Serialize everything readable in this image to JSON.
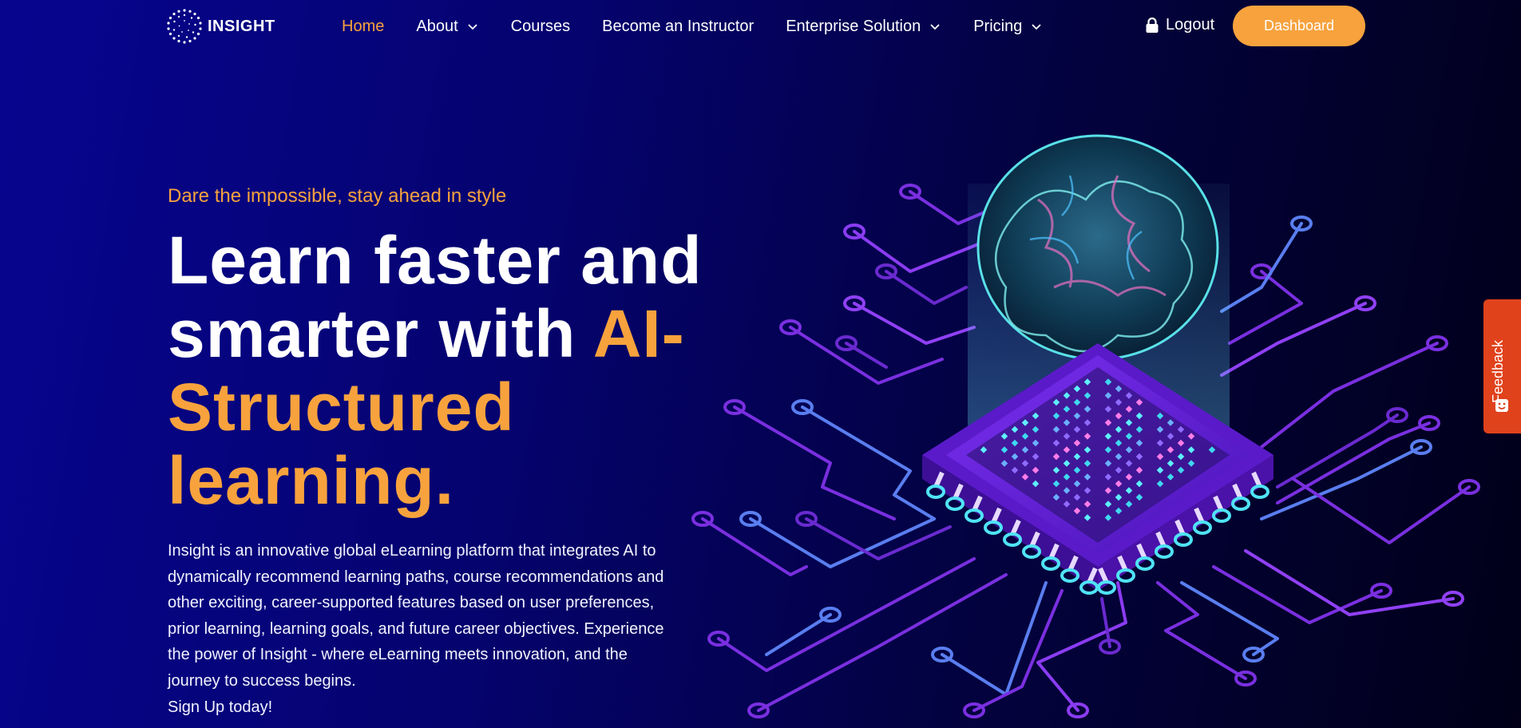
{
  "nav": {
    "logo_text": "INSIGHT",
    "items": [
      {
        "label": "Home",
        "active": true,
        "dropdown": false
      },
      {
        "label": "About",
        "active": false,
        "dropdown": true
      },
      {
        "label": "Courses",
        "active": false,
        "dropdown": false
      },
      {
        "label": "Become an Instructor",
        "active": false,
        "dropdown": false
      },
      {
        "label": "Enterprise Solution",
        "active": false,
        "dropdown": true
      },
      {
        "label": "Pricing",
        "active": false,
        "dropdown": true
      }
    ],
    "logout_label": "Logout",
    "dashboard_label": "Dashboard"
  },
  "hero": {
    "tagline": "Dare the impossible, stay ahead in style",
    "headline_part1": "Learn faster and smarter with ",
    "headline_accent": "AI-Structured learning.",
    "description": "Insight is an innovative global eLearning platform that integrates AI to dynamically recommend learning paths, course recommendations and other exciting, career-supported features based on user preferences, prior learning, learning goals, and future career objectives. Experience the power of Insight - where eLearning meets innovation, and the journey to success begins.",
    "signup_text": "Sign Up today!"
  },
  "feedback": {
    "label": "Feedback"
  },
  "colors": {
    "accent": "#f7a23d",
    "feedback": "#e0421c",
    "background": "#07058f"
  },
  "icons": [
    "logo-icon",
    "chevron-down-icon",
    "lock-icon",
    "feedback-icon"
  ]
}
